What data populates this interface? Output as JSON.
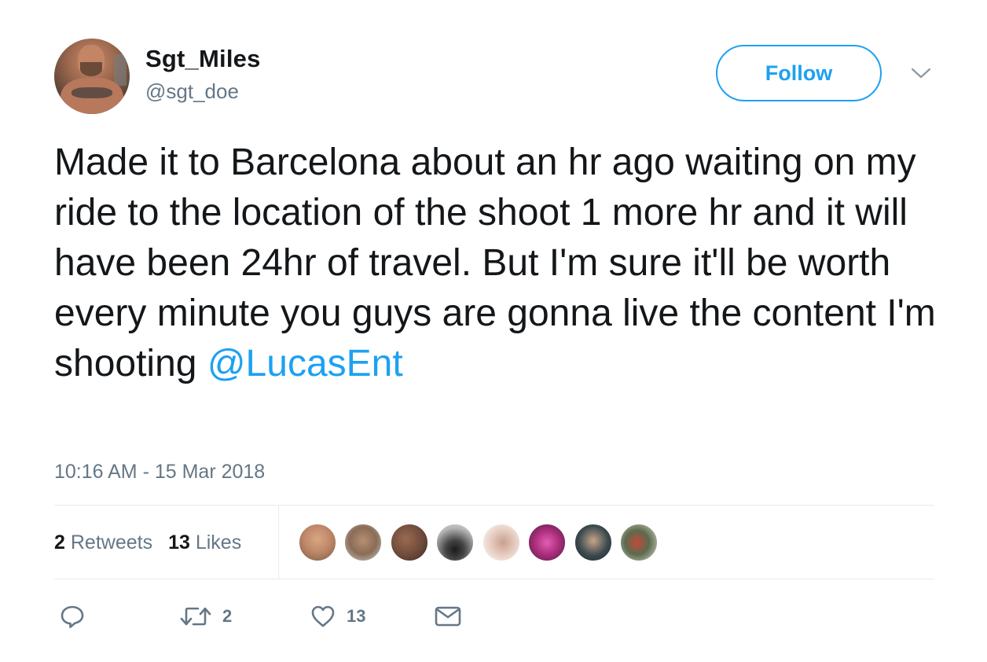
{
  "user": {
    "display_name": "Sgt_Miles",
    "handle": "@sgt_doe"
  },
  "follow_label": "Follow",
  "tweet": {
    "text": "Made it to Barcelona about an hr ago waiting on my ride to the location of the shoot 1 more hr and it will have been 24hr of travel. But I'm sure it'll be worth every minute you guys are gonna live the content I'm shooting",
    "mention": "@LucasEnt",
    "timestamp": "10:16 AM - 15 Mar 2018"
  },
  "stats": {
    "retweets_count": "2",
    "retweets_label": "Retweets",
    "likes_count": "13",
    "likes_label": "Likes"
  },
  "likers": [
    {
      "icon": "liker-avatar-1",
      "color": "#c08a6a"
    },
    {
      "icon": "liker-avatar-2",
      "color": "#8a6c57"
    },
    {
      "icon": "liker-avatar-3",
      "color": "#6e4a3a"
    },
    {
      "icon": "liker-avatar-4",
      "color": "#9a9a9a"
    },
    {
      "icon": "liker-avatar-5",
      "color": "#e8cfc4"
    },
    {
      "icon": "liker-avatar-6",
      "color": "#b0307f"
    },
    {
      "icon": "liker-avatar-7",
      "color": "#3b4a4f"
    },
    {
      "icon": "liker-avatar-8",
      "color": "#5c6b4d"
    }
  ],
  "actions": {
    "reply_icon": "reply-icon",
    "retweet_icon": "retweet-icon",
    "retweet_count": "2",
    "like_icon": "heart-icon",
    "like_count": "13",
    "message_icon": "envelope-icon"
  },
  "colors": {
    "accent": "#1da1f2",
    "secondary_text": "#657786",
    "primary_text": "#14171a",
    "divider": "#e6ecf0"
  }
}
